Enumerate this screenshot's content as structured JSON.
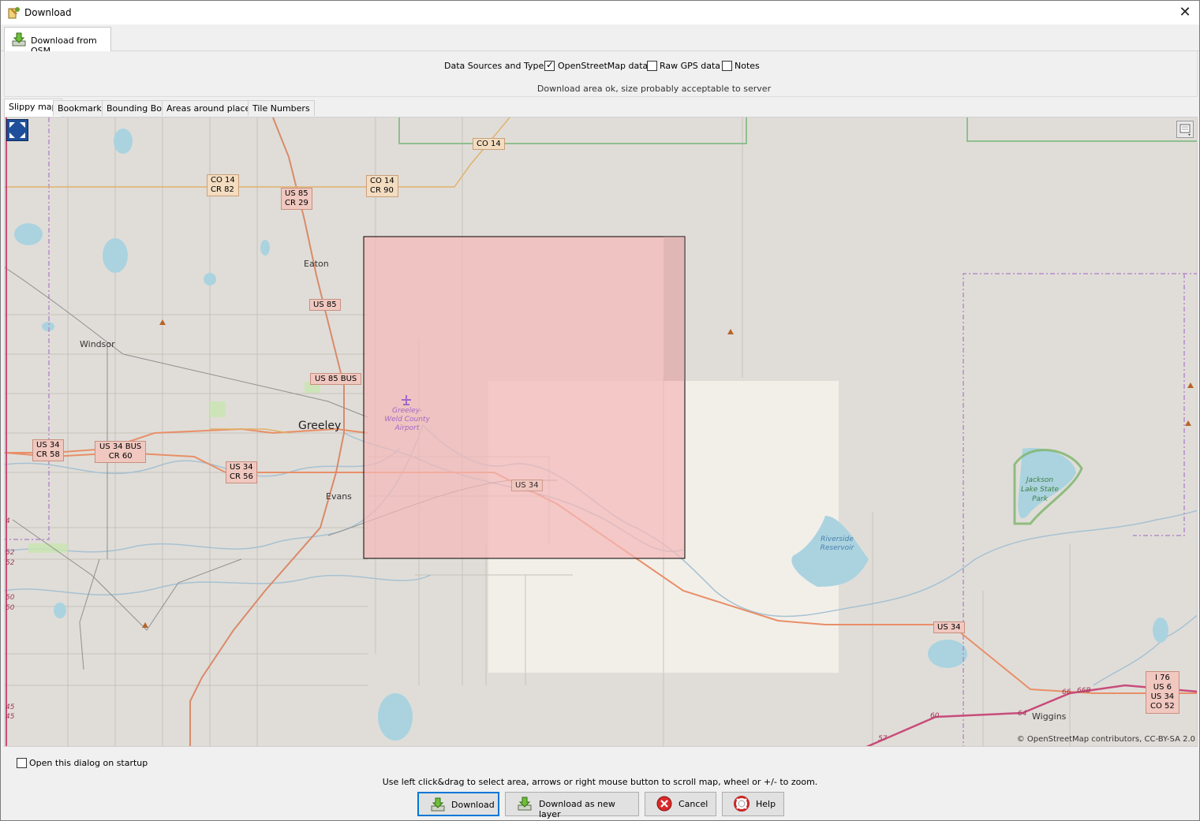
{
  "window": {
    "title": "Download",
    "close_glyph": "✕"
  },
  "main_tab": {
    "label": "Download from OSM",
    "icon": "download-arrow-icon"
  },
  "sources": {
    "label": "Data Sources and Types:",
    "options": [
      {
        "label": "OpenStreetMap data",
        "checked": true
      },
      {
        "label": "Raw GPS data",
        "checked": false
      },
      {
        "label": "Notes",
        "checked": false
      }
    ],
    "status": "Download area ok, size probably acceptable to server"
  },
  "subtabs": [
    "Slippy map",
    "Bookmarks",
    "Bounding Box",
    "Areas around places",
    "Tile Numbers"
  ],
  "map": {
    "places": [
      "Eaton",
      "Windsor",
      "Greeley",
      "Evans",
      "Wiggins"
    ],
    "airport": [
      "Greeley-",
      "Weld County",
      "Airport"
    ],
    "reservoir": [
      "Riverside",
      "Reservoir"
    ],
    "park": [
      "Jackson",
      "Lake State",
      "Park"
    ],
    "shields": {
      "co14_top": "CO 14",
      "co14_cr82": [
        "CO 14",
        "CR 82"
      ],
      "us85_cr29": [
        "US 85",
        "CR 29"
      ],
      "co14_cr90": [
        "CO 14",
        "CR 90"
      ],
      "us85": "US 85",
      "us85bus": "US 85 BUS",
      "us34_cr58": [
        "US 34",
        "CR 58"
      ],
      "us34bus_cr60": [
        "US 34 BUS",
        "CR 60"
      ],
      "us34_cr56": [
        "US 34",
        "CR 56"
      ],
      "us34_mid": "US 34",
      "us34_east": "US 34",
      "i76": [
        "I 76",
        "US 6",
        "US 34",
        "CO 52"
      ]
    },
    "road_numbers": [
      "66",
      "66B",
      "64",
      "60",
      "57"
    ],
    "edge_numbers": [
      "4",
      "52",
      "52",
      "50",
      "50",
      "45",
      "45"
    ],
    "attribution": "© OpenStreetMap contributors, CC-BY-SA 2.0",
    "selection_color": "#f5b8b8"
  },
  "footer": {
    "startup_label": "Open this dialog on startup",
    "startup_checked": false,
    "hint": "Use left click&drag to select area, arrows or right mouse button to scroll map, wheel or +/- to zoom.",
    "buttons": {
      "download": "Download",
      "download_new_layer": "Download as new layer",
      "cancel": "Cancel",
      "help": "Help"
    }
  }
}
